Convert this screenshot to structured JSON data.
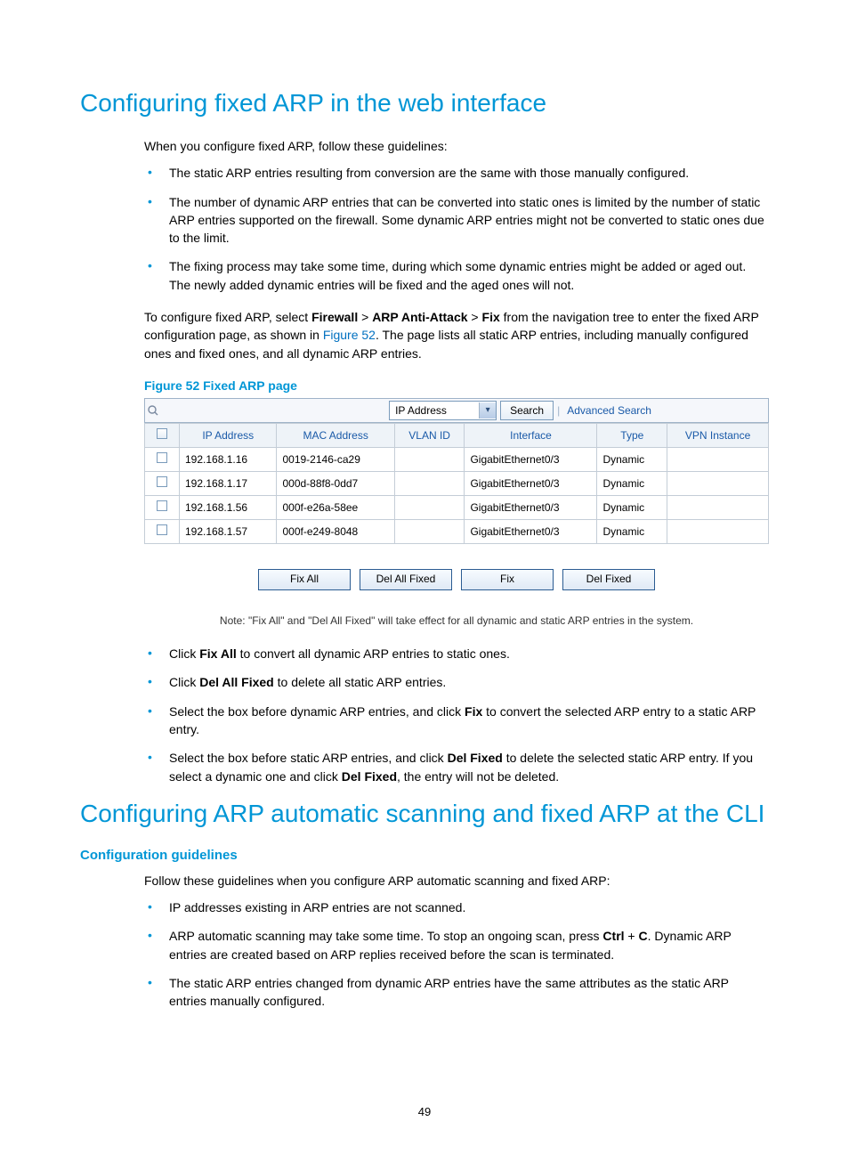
{
  "h1_a": "Configuring fixed ARP in the web interface",
  "p_intro": "When you configure fixed ARP, follow these guidelines:",
  "bullets_a": [
    "The static ARP entries resulting from conversion are the same with those manually configured.",
    "The number of dynamic ARP entries that can be converted into static ones is limited by the number of static ARP entries supported on the firewall. Some dynamic ARP entries might not be converted to static ones due to the limit.",
    "The fixing process may take some time, during which some dynamic entries might be added or aged out. The newly added dynamic entries will be fixed and the aged ones will not."
  ],
  "nav_sentence": {
    "pre": "To configure fixed ARP, select ",
    "b1": "Firewall",
    "gt": " > ",
    "b2": "ARP Anti-Attack",
    "b3": "Fix",
    "mid": " from the navigation tree to enter the fixed ARP configuration page, as shown in ",
    "link": "Figure 52",
    "post": ". The page lists all static ARP entries, including manually configured ones and fixed ones, and all dynamic ARP entries."
  },
  "fig_caption": "Figure 52 Fixed ARP page",
  "shot": {
    "select_label": "IP Address",
    "search_btn": "Search",
    "advanced": "Advanced Search",
    "headers": [
      "IP Address",
      "MAC Address",
      "VLAN ID",
      "Interface",
      "Type",
      "VPN Instance"
    ],
    "rows": [
      {
        "ip": "192.168.1.16",
        "mac": "0019-2146-ca29",
        "vlan": "",
        "iface": "GigabitEthernet0/3",
        "type": "Dynamic",
        "vpn": ""
      },
      {
        "ip": "192.168.1.17",
        "mac": "000d-88f8-0dd7",
        "vlan": "",
        "iface": "GigabitEthernet0/3",
        "type": "Dynamic",
        "vpn": ""
      },
      {
        "ip": "192.168.1.56",
        "mac": "000f-e26a-58ee",
        "vlan": "",
        "iface": "GigabitEthernet0/3",
        "type": "Dynamic",
        "vpn": ""
      },
      {
        "ip": "192.168.1.57",
        "mac": "000f-e249-8048",
        "vlan": "",
        "iface": "GigabitEthernet0/3",
        "type": "Dynamic",
        "vpn": ""
      }
    ],
    "buttons": [
      "Fix All",
      "Del All Fixed",
      "Fix",
      "Del Fixed"
    ],
    "note": "Note: \"Fix All\" and \"Del All Fixed\" will take effect for all dynamic and static ARP entries in the system."
  },
  "bullets_b": [
    {
      "pre": "Click ",
      "b": "Fix All",
      "post": " to convert all dynamic ARP entries to static ones."
    },
    {
      "pre": "Click ",
      "b": "Del All Fixed",
      "post": " to delete all static ARP entries."
    },
    {
      "pre": "Select the box before dynamic ARP entries, and click ",
      "b": "Fix",
      "post": " to convert the selected ARP entry to a static ARP entry."
    },
    {
      "pre": "Select the box before static ARP entries, and click ",
      "b": "Del Fixed",
      "post": " to delete the selected static ARP entry. If you select a dynamic one and click ",
      "b2": "Del Fixed",
      "post2": ", the entry will not be deleted."
    }
  ],
  "h1_b": "Configuring ARP automatic scanning and fixed ARP at the CLI",
  "h3": "Configuration guidelines",
  "p2": "Follow these guidelines when you configure ARP automatic scanning and fixed ARP:",
  "bullets_c": [
    {
      "text": "IP addresses existing in ARP entries are not scanned."
    },
    {
      "pre": "ARP automatic scanning may take some time. To stop an ongoing scan, press ",
      "b": "Ctrl",
      "mid": " + ",
      "b2": "C",
      "post": ". Dynamic ARP entries are created based on ARP replies received before the scan is terminated."
    },
    {
      "text": "The static ARP entries changed from dynamic ARP entries have the same attributes as the static ARP entries manually configured."
    }
  ],
  "page_number": "49"
}
